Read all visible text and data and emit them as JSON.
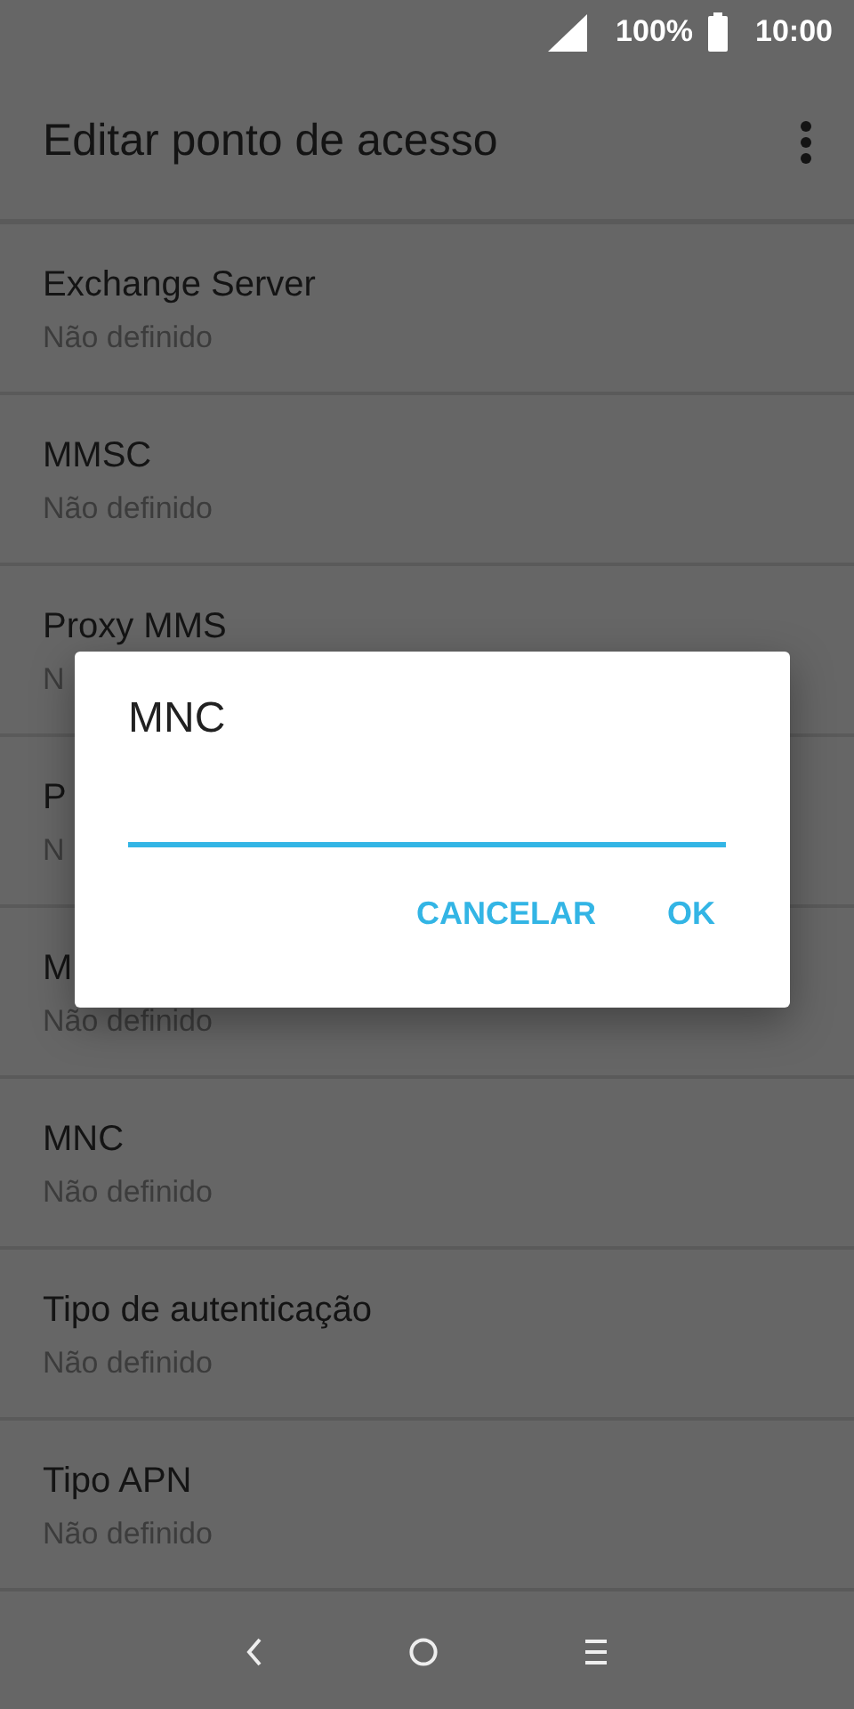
{
  "status_bar": {
    "battery": "100%",
    "time": "10:00"
  },
  "app_bar": {
    "title": "Editar ponto de acesso"
  },
  "settings": [
    {
      "title": "Exchange Server",
      "value": "Não definido"
    },
    {
      "title": "MMSC",
      "value": "Não definido"
    },
    {
      "title": "Proxy MMS",
      "value": "N"
    },
    {
      "title": "P",
      "value": "N"
    },
    {
      "title": "M",
      "value": "Não definido"
    },
    {
      "title": "MNC",
      "value": "Não definido"
    },
    {
      "title": "Tipo de autenticação",
      "value": "Não definido"
    },
    {
      "title": "Tipo APN",
      "value": "Não definido"
    }
  ],
  "dialog": {
    "title": "MNC",
    "buttons": [
      "CANCELAR",
      "OK"
    ]
  }
}
